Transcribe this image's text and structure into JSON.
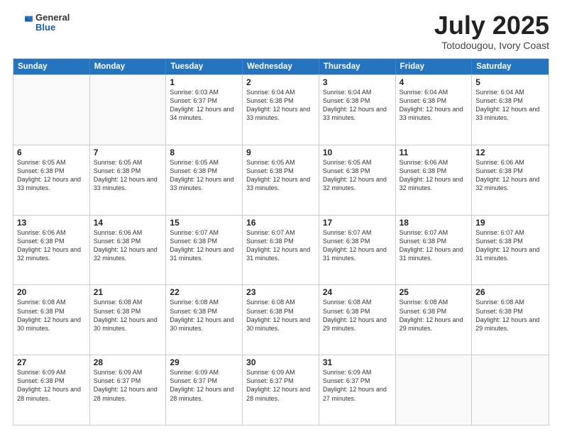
{
  "header": {
    "logo_general": "General",
    "logo_blue": "Blue",
    "title_month": "July 2025",
    "title_location": "Totodougou, Ivory Coast"
  },
  "calendar": {
    "weekdays": [
      "Sunday",
      "Monday",
      "Tuesday",
      "Wednesday",
      "Thursday",
      "Friday",
      "Saturday"
    ],
    "rows": [
      [
        {
          "day": "",
          "empty": true
        },
        {
          "day": "",
          "empty": true
        },
        {
          "day": "1",
          "sunrise": "Sunrise: 6:03 AM",
          "sunset": "Sunset: 6:37 PM",
          "daylight": "Daylight: 12 hours and 34 minutes."
        },
        {
          "day": "2",
          "sunrise": "Sunrise: 6:04 AM",
          "sunset": "Sunset: 6:38 PM",
          "daylight": "Daylight: 12 hours and 33 minutes."
        },
        {
          "day": "3",
          "sunrise": "Sunrise: 6:04 AM",
          "sunset": "Sunset: 6:38 PM",
          "daylight": "Daylight: 12 hours and 33 minutes."
        },
        {
          "day": "4",
          "sunrise": "Sunrise: 6:04 AM",
          "sunset": "Sunset: 6:38 PM",
          "daylight": "Daylight: 12 hours and 33 minutes."
        },
        {
          "day": "5",
          "sunrise": "Sunrise: 6:04 AM",
          "sunset": "Sunset: 6:38 PM",
          "daylight": "Daylight: 12 hours and 33 minutes."
        }
      ],
      [
        {
          "day": "6",
          "sunrise": "Sunrise: 6:05 AM",
          "sunset": "Sunset: 6:38 PM",
          "daylight": "Daylight: 12 hours and 33 minutes."
        },
        {
          "day": "7",
          "sunrise": "Sunrise: 6:05 AM",
          "sunset": "Sunset: 6:38 PM",
          "daylight": "Daylight: 12 hours and 33 minutes."
        },
        {
          "day": "8",
          "sunrise": "Sunrise: 6:05 AM",
          "sunset": "Sunset: 6:38 PM",
          "daylight": "Daylight: 12 hours and 33 minutes."
        },
        {
          "day": "9",
          "sunrise": "Sunrise: 6:05 AM",
          "sunset": "Sunset: 6:38 PM",
          "daylight": "Daylight: 12 hours and 33 minutes."
        },
        {
          "day": "10",
          "sunrise": "Sunrise: 6:05 AM",
          "sunset": "Sunset: 6:38 PM",
          "daylight": "Daylight: 12 hours and 32 minutes."
        },
        {
          "day": "11",
          "sunrise": "Sunrise: 6:06 AM",
          "sunset": "Sunset: 6:38 PM",
          "daylight": "Daylight: 12 hours and 32 minutes."
        },
        {
          "day": "12",
          "sunrise": "Sunrise: 6:06 AM",
          "sunset": "Sunset: 6:38 PM",
          "daylight": "Daylight: 12 hours and 32 minutes."
        }
      ],
      [
        {
          "day": "13",
          "sunrise": "Sunrise: 6:06 AM",
          "sunset": "Sunset: 6:38 PM",
          "daylight": "Daylight: 12 hours and 32 minutes."
        },
        {
          "day": "14",
          "sunrise": "Sunrise: 6:06 AM",
          "sunset": "Sunset: 6:38 PM",
          "daylight": "Daylight: 12 hours and 32 minutes."
        },
        {
          "day": "15",
          "sunrise": "Sunrise: 6:07 AM",
          "sunset": "Sunset: 6:38 PM",
          "daylight": "Daylight: 12 hours and 31 minutes."
        },
        {
          "day": "16",
          "sunrise": "Sunrise: 6:07 AM",
          "sunset": "Sunset: 6:38 PM",
          "daylight": "Daylight: 12 hours and 31 minutes."
        },
        {
          "day": "17",
          "sunrise": "Sunrise: 6:07 AM",
          "sunset": "Sunset: 6:38 PM",
          "daylight": "Daylight: 12 hours and 31 minutes."
        },
        {
          "day": "18",
          "sunrise": "Sunrise: 6:07 AM",
          "sunset": "Sunset: 6:38 PM",
          "daylight": "Daylight: 12 hours and 31 minutes."
        },
        {
          "day": "19",
          "sunrise": "Sunrise: 6:07 AM",
          "sunset": "Sunset: 6:38 PM",
          "daylight": "Daylight: 12 hours and 31 minutes."
        }
      ],
      [
        {
          "day": "20",
          "sunrise": "Sunrise: 6:08 AM",
          "sunset": "Sunset: 6:38 PM",
          "daylight": "Daylight: 12 hours and 30 minutes."
        },
        {
          "day": "21",
          "sunrise": "Sunrise: 6:08 AM",
          "sunset": "Sunset: 6:38 PM",
          "daylight": "Daylight: 12 hours and 30 minutes."
        },
        {
          "day": "22",
          "sunrise": "Sunrise: 6:08 AM",
          "sunset": "Sunset: 6:38 PM",
          "daylight": "Daylight: 12 hours and 30 minutes."
        },
        {
          "day": "23",
          "sunrise": "Sunrise: 6:08 AM",
          "sunset": "Sunset: 6:38 PM",
          "daylight": "Daylight: 12 hours and 30 minutes."
        },
        {
          "day": "24",
          "sunrise": "Sunrise: 6:08 AM",
          "sunset": "Sunset: 6:38 PM",
          "daylight": "Daylight: 12 hours and 29 minutes."
        },
        {
          "day": "25",
          "sunrise": "Sunrise: 6:08 AM",
          "sunset": "Sunset: 6:38 PM",
          "daylight": "Daylight: 12 hours and 29 minutes."
        },
        {
          "day": "26",
          "sunrise": "Sunrise: 6:08 AM",
          "sunset": "Sunset: 6:38 PM",
          "daylight": "Daylight: 12 hours and 29 minutes."
        }
      ],
      [
        {
          "day": "27",
          "sunrise": "Sunrise: 6:09 AM",
          "sunset": "Sunset: 6:38 PM",
          "daylight": "Daylight: 12 hours and 28 minutes."
        },
        {
          "day": "28",
          "sunrise": "Sunrise: 6:09 AM",
          "sunset": "Sunset: 6:37 PM",
          "daylight": "Daylight: 12 hours and 28 minutes."
        },
        {
          "day": "29",
          "sunrise": "Sunrise: 6:09 AM",
          "sunset": "Sunset: 6:37 PM",
          "daylight": "Daylight: 12 hours and 28 minutes."
        },
        {
          "day": "30",
          "sunrise": "Sunrise: 6:09 AM",
          "sunset": "Sunset: 6:37 PM",
          "daylight": "Daylight: 12 hours and 28 minutes."
        },
        {
          "day": "31",
          "sunrise": "Sunrise: 6:09 AM",
          "sunset": "Sunset: 6:37 PM",
          "daylight": "Daylight: 12 hours and 27 minutes."
        },
        {
          "day": "",
          "empty": true
        },
        {
          "day": "",
          "empty": true
        }
      ]
    ]
  }
}
